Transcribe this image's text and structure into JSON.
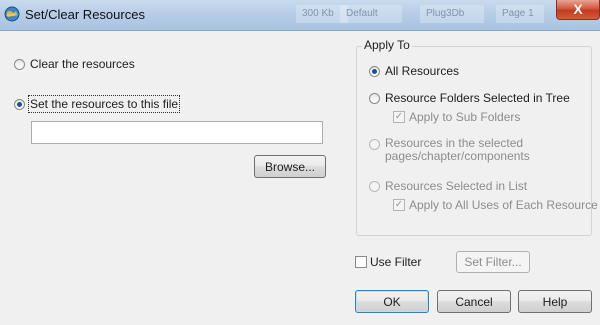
{
  "window": {
    "title": "Set/Clear Resources",
    "close_glyph": "X",
    "background_ghost": [
      "300 Kb",
      "Default",
      "Plug3Db",
      "Page 1"
    ]
  },
  "left": {
    "clear_label": "Clear the resources",
    "set_label": "Set the resources to this file",
    "file_value": "",
    "browse_label": "Browse..."
  },
  "apply_to": {
    "legend": "Apply To",
    "all_resources": "All Resources",
    "folders_selected": "Resource Folders Selected in Tree",
    "apply_sub_folders": "Apply to Sub Folders",
    "selected_pages_line1": "Resources in the selected",
    "selected_pages_line2": "pages/chapter/components",
    "selected_in_list": "Resources Selected in List",
    "apply_all_uses": "Apply to All Uses of Each Resource",
    "check_glyph": "✓"
  },
  "filter": {
    "use_filter_label": "Use Filter",
    "set_filter_label": "Set Filter..."
  },
  "footer": {
    "ok_label": "OK",
    "cancel_label": "Cancel",
    "help_label": "Help"
  }
}
